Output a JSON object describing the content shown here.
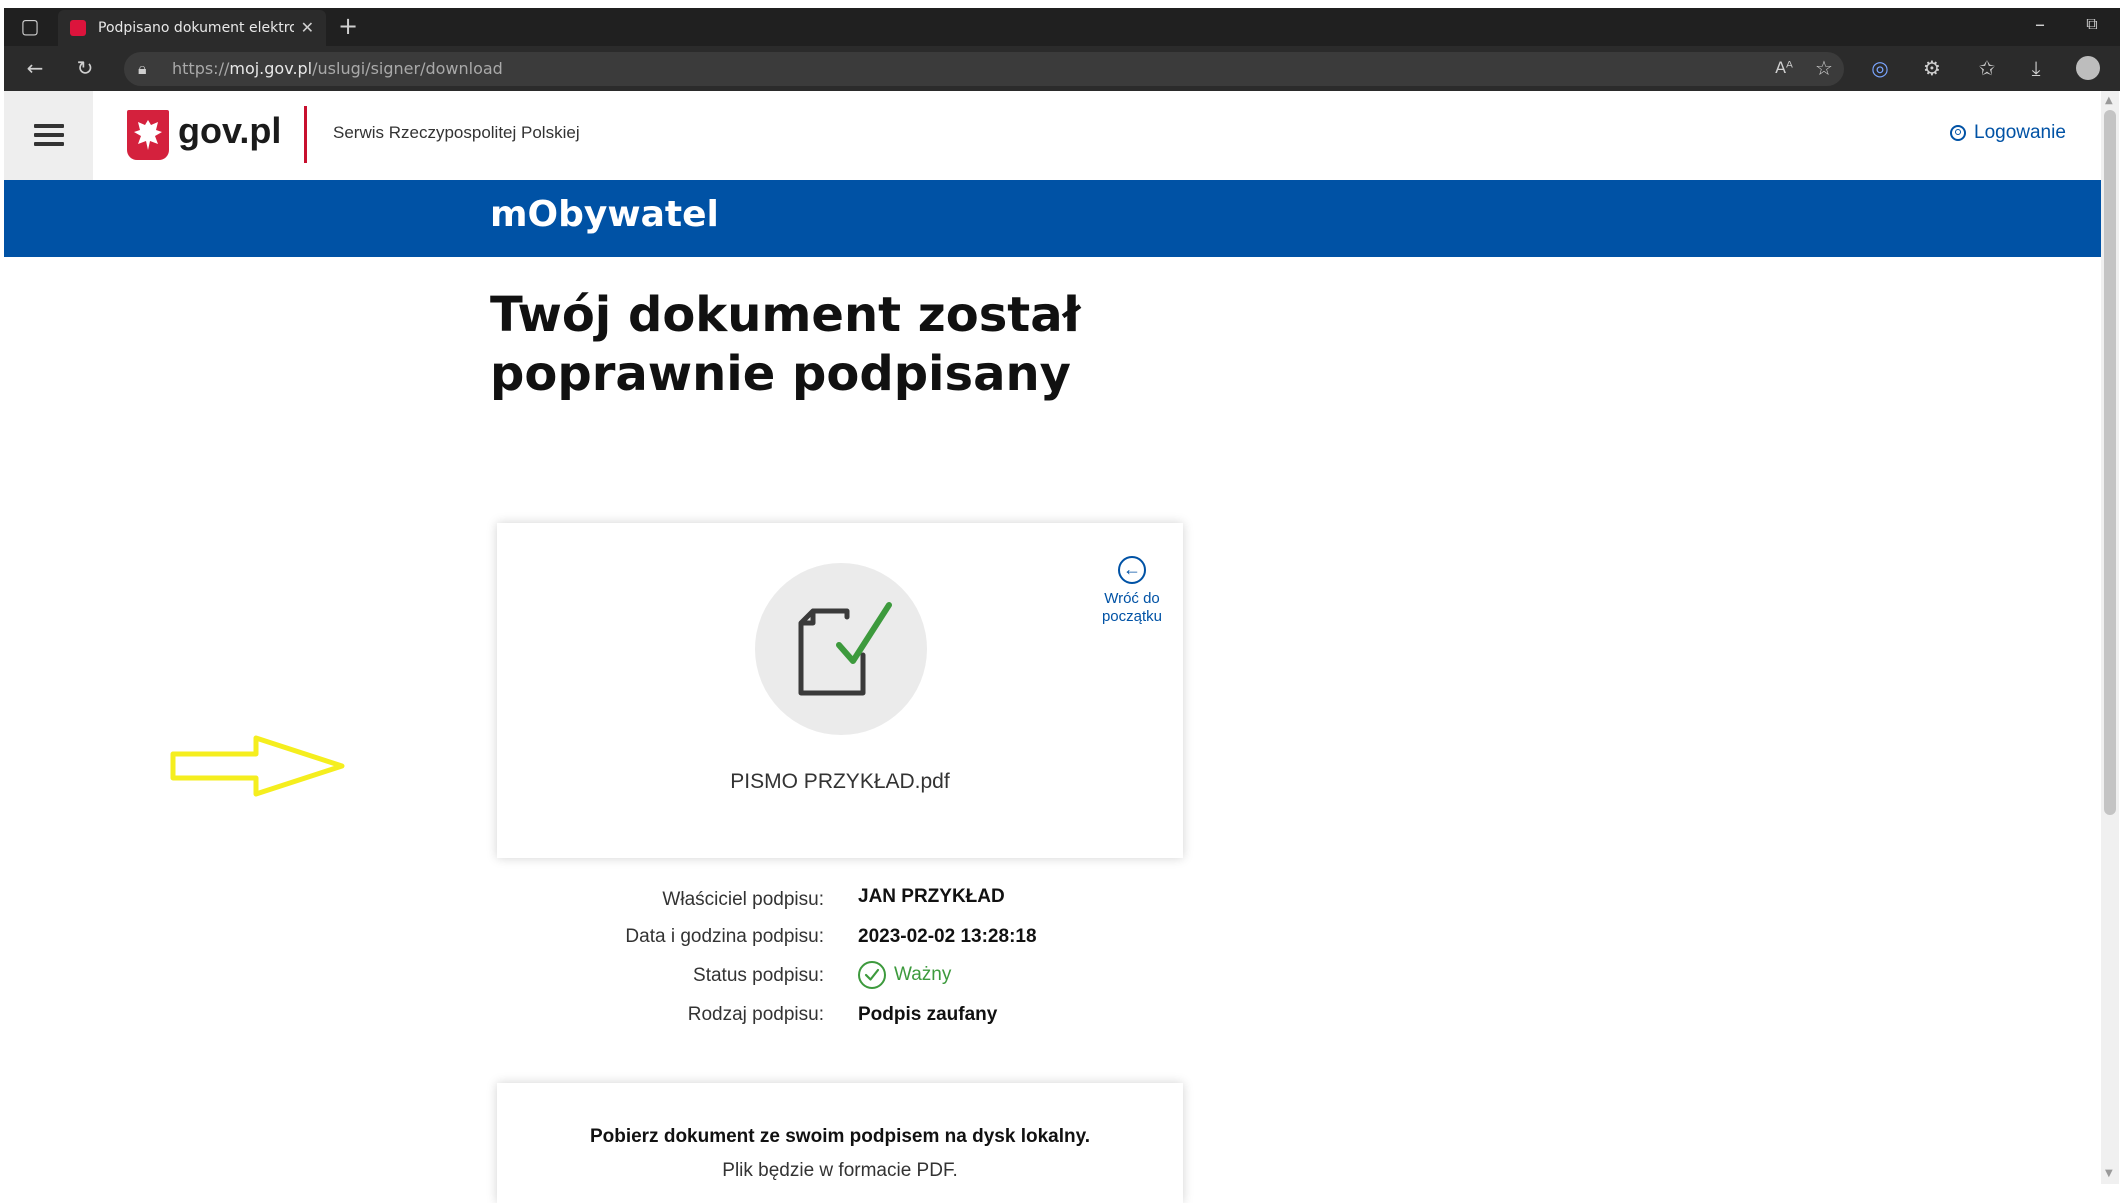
{
  "browser": {
    "tab_title": "Podpisano dokument elektroniczny",
    "new_tab": "+",
    "url_prefix": "https://",
    "url_host": "moj.gov.pl",
    "url_path": "/uslugi/signer/download"
  },
  "header": {
    "brand": "gov.pl",
    "subtitle": "Serwis Rzeczypospolitej Polskiej",
    "login": "Logowanie"
  },
  "band": {
    "title": "mObywatel"
  },
  "main": {
    "heading_line1": "Twój dokument został",
    "heading_line2": "poprawnie podpisany",
    "back_line1": "Wróć do",
    "back_line2": "początku",
    "filename": "PISMO PRZYKŁAD.pdf",
    "info": {
      "owner_label": "Właściciel podpisu:",
      "owner_value": "JAN PRZYKŁAD",
      "date_label": "Data i godzina podpisu:",
      "date_value": "2023-02-02 13:28:18",
      "status_label": "Status podpisu:",
      "status_value": "Ważny",
      "type_label": "Rodzaj podpisu:",
      "type_value": "Podpis zaufany"
    },
    "download": {
      "title": "Pobierz dokument ze swoim podpisem na dysk lokalny.",
      "subtitle": "Plik będzie w formacie PDF."
    }
  },
  "colors": {
    "brand_blue": "#0052a5",
    "gov_red": "#c8102e",
    "valid_green": "#3d9a3d",
    "annotation_yellow": "#f5ee1e"
  }
}
